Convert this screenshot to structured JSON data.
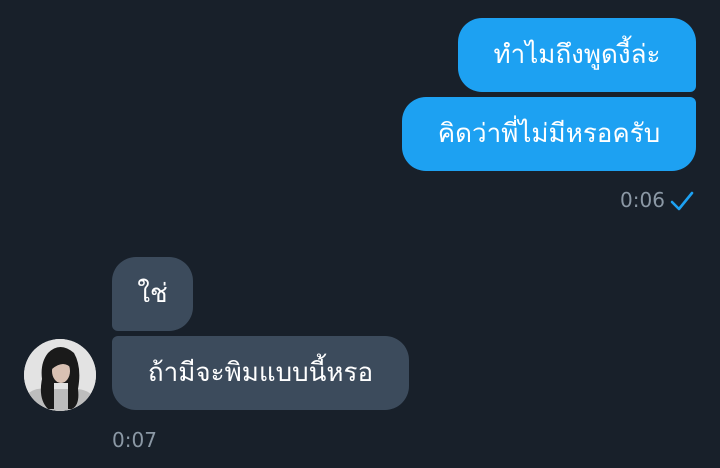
{
  "messages": {
    "sent": [
      {
        "text": "ทำไมถึงพูดงี้ล่ะ"
      },
      {
        "text": "คิดว่าพี่ไม่มีหรอครับ"
      }
    ],
    "sent_time": "0:06",
    "sent_status_icon": "checkmark-icon",
    "received": [
      {
        "text": "ใช่"
      },
      {
        "text": "ถ้ามีจะพิมแบบนี้หรอ"
      }
    ],
    "received_time": "0:07"
  },
  "colors": {
    "background": "#18202a",
    "sent_bubble": "#1da1f2",
    "received_bubble": "#3c4b5c",
    "timestamp": "#8b98a5"
  }
}
